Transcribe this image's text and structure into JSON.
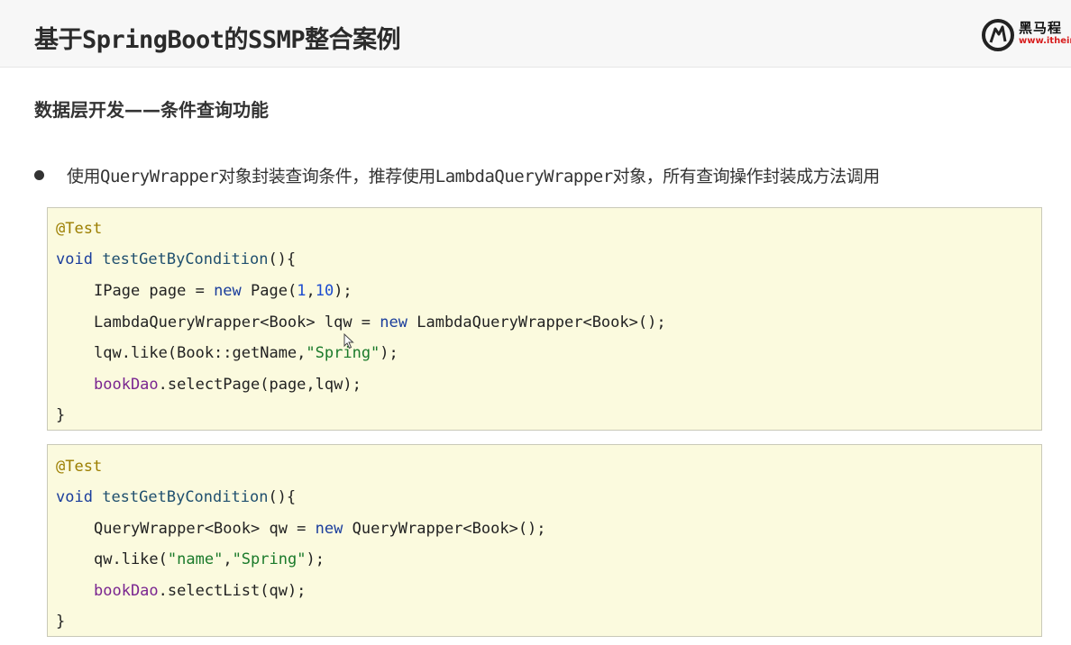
{
  "header": {
    "title": "基于SpringBoot的SSMP整合案例",
    "logo_name": "黑马程",
    "logo_url": "www.itheim"
  },
  "subtitle": "数据层开发——条件查询功能",
  "bullet": "使用QueryWrapper对象封装查询条件，推荐使用LambdaQueryWrapper对象，所有查询操作封装成方法调用",
  "code1": {
    "annotation": "@Test",
    "sig_void": "void",
    "sig_method": "testGetByCondition",
    "sig_rest": "(){",
    "l1_a": "IPage page = ",
    "l1_new": "new",
    "l1_b": " Page(",
    "l1_n1": "1",
    "l1_comma": ",",
    "l1_n2": "10",
    "l1_c": ");",
    "l2_a": "LambdaQueryWrapper<Book> lqw = ",
    "l2_new": "new",
    "l2_b": " LambdaQueryWrapper<Book>();",
    "l3_a": "lqw.like(Book::getName,",
    "l3_str": "\"Spring\"",
    "l3_b": ");",
    "l4_field": "bookDao",
    "l4_b": ".selectPage(page,lqw);",
    "close": "}"
  },
  "code2": {
    "annotation": "@Test",
    "sig_void": "void",
    "sig_method": "testGetByCondition",
    "sig_rest": "(){",
    "l1_a": "QueryWrapper<Book> qw = ",
    "l1_new": "new",
    "l1_b": " QueryWrapper<Book>();",
    "l2_a": "qw.like(",
    "l2_str1": "\"name\"",
    "l2_comma": ",",
    "l2_str2": "\"Spring\"",
    "l2_b": ");",
    "l3_field": "bookDao",
    "l3_b": ".selectList(qw);",
    "close": "}"
  },
  "colors": {
    "annotation": "#9c7e00",
    "keyword": "#1a3d9c",
    "string": "#1a7a2a",
    "field": "#7a2590",
    "code_bg": "#fbfade",
    "logo_red": "#d81e1e"
  }
}
